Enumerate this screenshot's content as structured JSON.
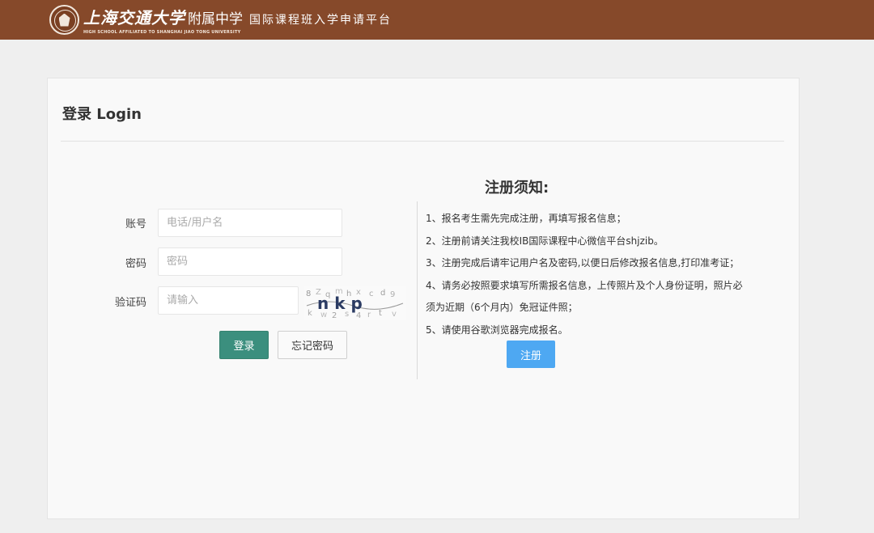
{
  "header": {
    "brand_sjtu": "上海交通大学",
    "brand_school": "附属中学",
    "brand_platform": "国际课程班入学申请平台",
    "brand_en": "HIGH SCHOOL AFFILIATED TO SHANGHAI JIAO TONG UNIVERSITY",
    "bar_color": "#86492a"
  },
  "login": {
    "title": "登录 Login",
    "account_label": "账号",
    "account_placeholder": "电话/用户名",
    "password_label": "密码",
    "password_placeholder": "密码",
    "captcha_label": "验证码",
    "captcha_placeholder": "请输入",
    "captcha_text": "nkp",
    "login_button": "登录",
    "forgot_button": "忘记密码"
  },
  "notice": {
    "title": "注册须知:",
    "items": [
      "1、报名考生需先完成注册，再填写报名信息；",
      "2、注册前请关注我校IB国际课程中心微信平台shjzib。",
      "3、注册完成后请牢记用户名及密码,以便日后修改报名信息,打印准考证；",
      "4、请务必按照要求填写所需报名信息，上传照片及个人身份证明，照片必",
      "须为近期（6个月内）免冠证件照；",
      "5、请使用谷歌浏览器完成报名。"
    ],
    "register_button": "注册"
  },
  "colors": {
    "login_button": "#3b8f7e",
    "register_button": "#4ea8f2",
    "page_background": "#efefef"
  }
}
